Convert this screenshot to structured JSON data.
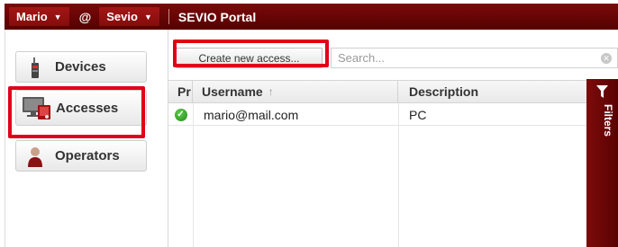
{
  "topbar": {
    "user_label": "Mario",
    "at_symbol": "@",
    "company_label": "Sevio",
    "portal_title": "SEVIO Portal",
    "bar_color": "#6b0505"
  },
  "sidebar": {
    "items": [
      {
        "label": "Devices",
        "icon": "device-icon"
      },
      {
        "label": "Accesses",
        "icon": "accesses-icon",
        "selected": true
      },
      {
        "label": "Operators",
        "icon": "operator-icon"
      }
    ]
  },
  "toolbar": {
    "create_label": "Create new access...",
    "search_placeholder": "Search..."
  },
  "table": {
    "columns": [
      "Pr",
      "Username",
      "Description"
    ],
    "sort_indicator": "↑",
    "rows": [
      {
        "status": "ok",
        "username": "mario@mail.com",
        "description": "PC"
      }
    ]
  },
  "filters": {
    "label": "Filters"
  },
  "colors": {
    "accent": "#7a0a0a",
    "highlight": "#e1001a",
    "status_ok": "#2aa21f"
  }
}
